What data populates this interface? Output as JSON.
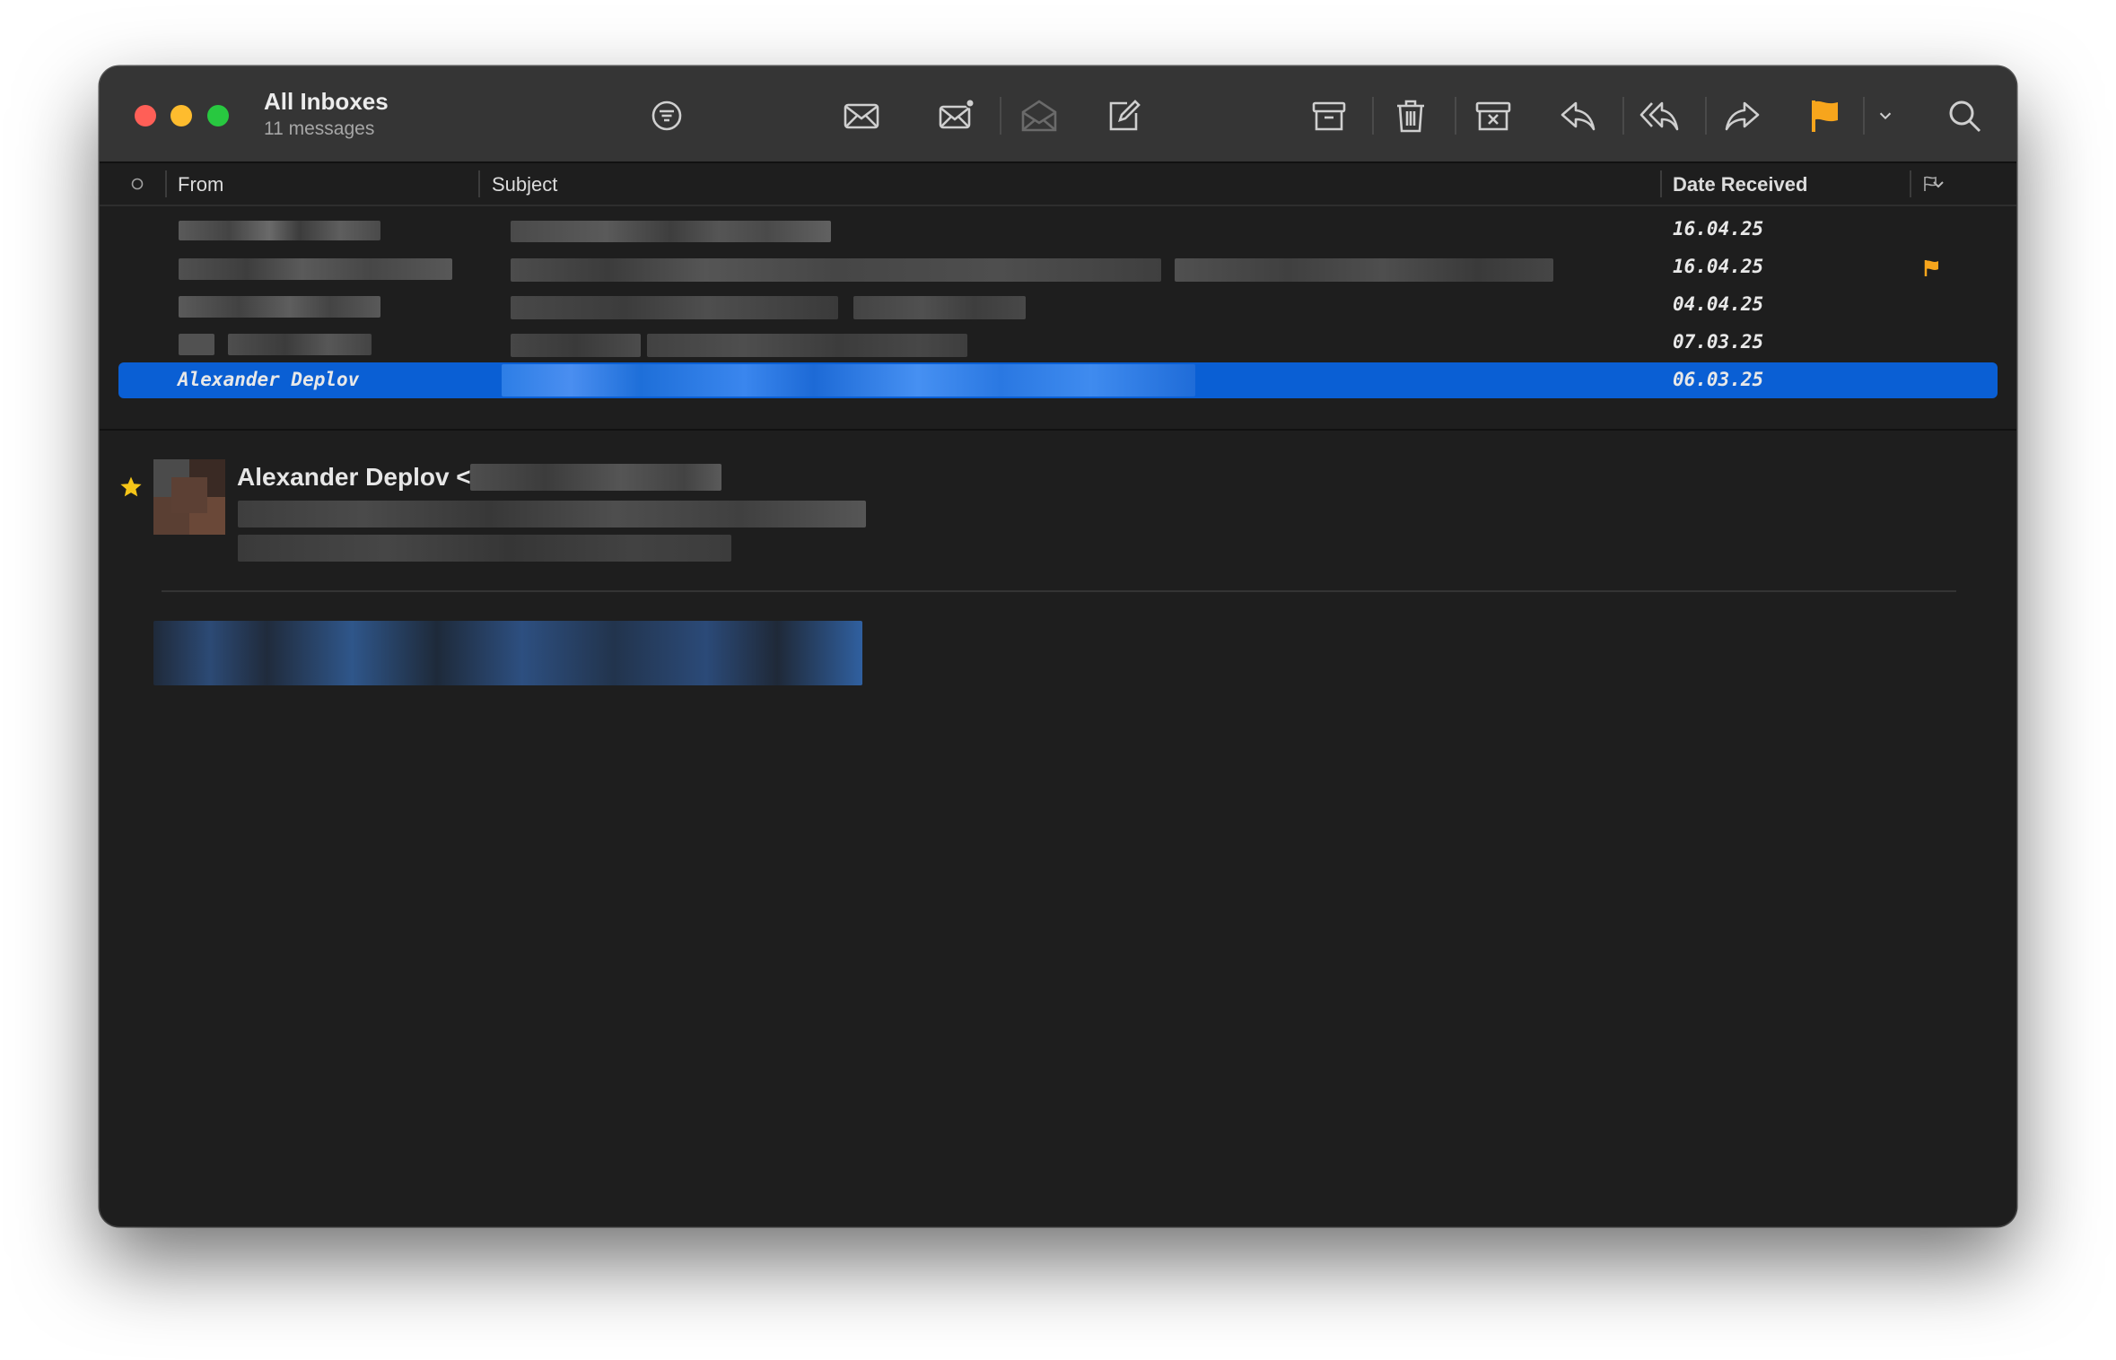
{
  "window": {
    "title": "All Inboxes",
    "subtitle": "11 messages"
  },
  "toolbar": {
    "icons": [
      "filter-icon",
      "envelope-icon",
      "envelope-badge-icon",
      "envelope-open-icon",
      "compose-icon",
      "archive-icon",
      "trash-icon",
      "junk-icon",
      "reply-icon",
      "reply-all-icon",
      "forward-icon",
      "flag-icon",
      "chevron-down-icon",
      "search-icon"
    ],
    "flag_color": "#f7a51c"
  },
  "columns": {
    "from": "From",
    "subject": "Subject",
    "date": "Date Received"
  },
  "messages": [
    {
      "date": "16.04.25",
      "flagged": false
    },
    {
      "date": "16.04.25",
      "flagged": true
    },
    {
      "date": "04.04.25",
      "flagged": false
    },
    {
      "date": "07.03.25",
      "flagged": false
    },
    {
      "from": "Alexander Deplov",
      "date": "06.03.25",
      "selected": true,
      "flagged": false
    }
  ],
  "preview": {
    "sender": "Alexander Deplov <",
    "star_color": "#f5c518"
  },
  "colors": {
    "accent": "#0a5fd4",
    "flag": "#f7a51c"
  }
}
